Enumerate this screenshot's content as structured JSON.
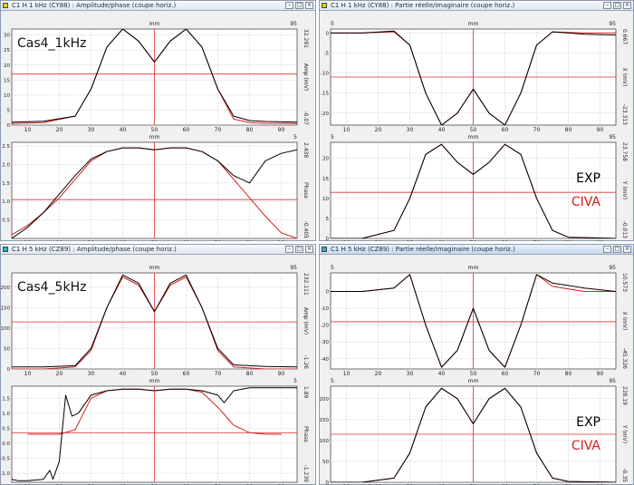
{
  "colors": {
    "exp": "#000000",
    "civa": "#d42020",
    "crosshair": "#e03030",
    "grid": "#b8b8b8",
    "accent_cyan": "#2fb0c8",
    "accent_yellow": "#e8d000"
  },
  "windows": [
    {
      "title": "C1 H 1 kHz (CY88) : Amplitude/phase (coupe horiz.)",
      "icon_color": "#e8d000",
      "active": false,
      "case_label": "Cas4_1kHz",
      "legend": null,
      "plots": [
        {
          "xlabel": "mm",
          "xmax_label": "95",
          "ylabel": "Amp (mV)",
          "right_top": "32.291",
          "right_bottom": "-0.07",
          "ylim": [
            0,
            32
          ],
          "yticks": [
            "0",
            "5",
            "10",
            "15",
            "20",
            "25",
            "30"
          ],
          "xticks": [
            "10",
            "20",
            "30",
            "40",
            "50",
            "60",
            "70",
            "80",
            "90"
          ],
          "hline": 17,
          "vline": 50
        },
        {
          "xlabel": "mm",
          "xmax_label": "5",
          "ylabel": "Phase",
          "right_top": "2.438",
          "right_bottom": "-0.405",
          "ylim": [
            0,
            2.6
          ],
          "yticks": [
            "0.5",
            "1.0",
            "1.5",
            "2.0",
            "2.5"
          ],
          "xticks": [
            "10",
            "20",
            "30",
            "40",
            "50",
            "60",
            "70",
            "80",
            "90"
          ],
          "hline": 1.05,
          "vline": 50
        }
      ]
    },
    {
      "title": "C1 H 1 kHz (CY88) : Partie réelle/imaginaire (coupe horiz.)",
      "icon_color": "#e8d000",
      "active": false,
      "case_label": null,
      "legend": {
        "exp": "EXP",
        "civa": "CIVA"
      },
      "plots": [
        {
          "xlabel": "mm",
          "xmax_label": "95",
          "xmin_label": "5",
          "ylabel": "X (mV)",
          "right_top": "0.667",
          "right_bottom": "-23.313",
          "ylim": [
            -23,
            1
          ],
          "yticks": [
            "0",
            "-5",
            "-10",
            "-15",
            "-20"
          ],
          "xticks": [
            "10",
            "20",
            "30",
            "40",
            "50",
            "60",
            "70",
            "80",
            "90"
          ],
          "hline": -11,
          "vline": 50
        },
        {
          "xlabel": "mm",
          "xmax_label": "95",
          "xmin_label": "5",
          "ylabel": "Y (mV)",
          "right_top": "23.758",
          "right_bottom": "-0.013",
          "ylim": [
            0,
            24
          ],
          "yticks": [
            "0",
            "5",
            "10",
            "15",
            "20"
          ],
          "xticks": [
            "10",
            "20",
            "30",
            "40",
            "50",
            "60",
            "70",
            "80",
            "90"
          ],
          "hline": 11.5,
          "vline": 50
        }
      ]
    },
    {
      "title": "C1 H 5 kHz (CZ89) : Amplitude/phase (coupe horiz.)",
      "icon_color": "#2fb0c8",
      "active": false,
      "case_label": "Cas4_5kHz",
      "legend": null,
      "plots": [
        {
          "xlabel": "mm",
          "xmax_label": "95",
          "ylabel": "Amp (mV)",
          "right_top": "232.111",
          "right_bottom": "-1.26",
          "ylim": [
            0,
            235
          ],
          "yticks": [
            "0",
            "50",
            "100",
            "150",
            "200"
          ],
          "xticks": [
            "10",
            "20",
            "30",
            "40",
            "50",
            "60",
            "70",
            "80",
            "90"
          ],
          "hline": 115,
          "vline": 50
        },
        {
          "xlabel": "mm",
          "xmax_label": "5",
          "ylabel": "Phase",
          "right_top": "1.89",
          "right_bottom": "-1.239",
          "ylim": [
            -1.3,
            1.9
          ],
          "yticks": [
            "-1.0",
            "-0.5",
            "0.0",
            "0.5",
            "1.0",
            "1.5"
          ],
          "xticks": [
            "10",
            "20",
            "30",
            "40",
            "50",
            "60",
            "70",
            "80",
            "90"
          ],
          "hline": 0.35,
          "vline": 50
        }
      ]
    },
    {
      "title": "C1 H 5 kHz (CZ89) : Partie réelle/imaginaire (coupe horiz.)",
      "icon_color": "#2fb0c8",
      "active": true,
      "case_label": null,
      "legend": {
        "exp": "EXP",
        "civa": "CIVA"
      },
      "plots": [
        {
          "xlabel": "mm",
          "xmax_label": "95",
          "xmin_label": "5",
          "ylabel": "X (mV)",
          "right_top": "10.573",
          "right_bottom": "-45.326",
          "ylim": [
            -46,
            11
          ],
          "yticks": [
            "0",
            "-10",
            "-20",
            "-30",
            "-40"
          ],
          "xticks": [
            "10",
            "20",
            "30",
            "40",
            "50",
            "60",
            "70",
            "80",
            "90"
          ],
          "hline": -18,
          "vline": 50
        },
        {
          "xlabel": "mm",
          "xmax_label": "95",
          "xmin_label": "5",
          "ylabel": "Y (mV)",
          "right_top": "228.19",
          "right_bottom": "-0.35",
          "ylim": [
            0,
            230
          ],
          "yticks": [
            "0",
            "50",
            "100",
            "150",
            "200"
          ],
          "xticks": [
            "10",
            "20",
            "30",
            "40",
            "50",
            "60",
            "70",
            "80",
            "90"
          ],
          "hline": 115,
          "vline": 50
        }
      ]
    }
  ],
  "chart_data": [
    {
      "type": "line",
      "title": "",
      "xlabel": "mm",
      "ylabel": "Amp (mV)",
      "xlim": [
        5,
        95
      ],
      "ylim": [
        0,
        32
      ],
      "series": [
        {
          "name": "EXP",
          "x": [
            5,
            15,
            25,
            30,
            35,
            40,
            45,
            50,
            55,
            60,
            65,
            70,
            75,
            80,
            85,
            95
          ],
          "y": [
            1,
            1.3,
            3,
            12,
            26,
            32,
            28,
            21,
            28,
            32,
            26,
            12,
            3,
            1.5,
            1.2,
            1
          ]
        },
        {
          "name": "CIVA",
          "x": [
            5,
            15,
            25,
            30,
            35,
            40,
            45,
            50,
            55,
            60,
            65,
            70,
            75,
            80,
            85,
            95
          ],
          "y": [
            0.5,
            0.8,
            3,
            12,
            26,
            32,
            28,
            21,
            28,
            32,
            26,
            12,
            2,
            0.8,
            0.6,
            0.5
          ]
        }
      ]
    },
    {
      "type": "line",
      "title": "",
      "xlabel": "mm",
      "ylabel": "Phase",
      "xlim": [
        5,
        95
      ],
      "ylim": [
        0,
        2.6
      ],
      "series": [
        {
          "name": "EXP",
          "x": [
            5,
            10,
            15,
            20,
            25,
            30,
            35,
            40,
            45,
            50,
            55,
            60,
            65,
            70,
            75,
            80,
            85,
            90,
            95
          ],
          "y": [
            0,
            0.3,
            0.7,
            1.2,
            1.7,
            2.15,
            2.35,
            2.45,
            2.45,
            2.4,
            2.45,
            2.45,
            2.35,
            2.1,
            1.7,
            1.5,
            2.1,
            2.3,
            2.4
          ]
        },
        {
          "name": "CIVA",
          "x": [
            5,
            10,
            15,
            20,
            25,
            30,
            35,
            40,
            45,
            50,
            55,
            60,
            65,
            70,
            75,
            80,
            85,
            90,
            95
          ],
          "y": [
            0.1,
            0.35,
            0.7,
            1.1,
            1.6,
            2.1,
            2.35,
            2.45,
            2.45,
            2.4,
            2.45,
            2.45,
            2.35,
            2.1,
            1.6,
            1.1,
            0.6,
            0.15,
            0
          ]
        }
      ]
    },
    {
      "type": "line",
      "title": "",
      "xlabel": "mm",
      "ylabel": "X (mV)",
      "xlim": [
        5,
        95
      ],
      "ylim": [
        -23,
        1
      ],
      "series": [
        {
          "name": "EXP",
          "x": [
            5,
            15,
            25,
            30,
            35,
            40,
            45,
            50,
            55,
            60,
            65,
            70,
            75,
            85,
            95
          ],
          "y": [
            0,
            0,
            0.5,
            -3,
            -15,
            -23,
            -20,
            -14,
            -20,
            -23,
            -15,
            -3,
            0.3,
            -0.3,
            -0.5
          ]
        },
        {
          "name": "CIVA",
          "x": [
            5,
            15,
            25,
            30,
            35,
            40,
            45,
            50,
            55,
            60,
            65,
            70,
            75,
            85,
            95
          ],
          "y": [
            0,
            0,
            0.3,
            -3,
            -15,
            -23,
            -20,
            -14,
            -20,
            -23,
            -15,
            -3,
            0.3,
            0,
            0
          ]
        }
      ]
    },
    {
      "type": "line",
      "title": "",
      "xlabel": "mm",
      "ylabel": "Y (mV)",
      "xlim": [
        5,
        95
      ],
      "ylim": [
        0,
        24
      ],
      "series": [
        {
          "name": "EXP",
          "x": [
            5,
            15,
            25,
            30,
            35,
            40,
            45,
            50,
            55,
            60,
            65,
            70,
            75,
            80,
            95
          ],
          "y": [
            0,
            0,
            2,
            10,
            21,
            23.5,
            19,
            16,
            19,
            23.5,
            21,
            10,
            2,
            0.3,
            0
          ]
        },
        {
          "name": "CIVA",
          "x": [
            5,
            15,
            25,
            30,
            35,
            40,
            45,
            50,
            55,
            60,
            65,
            70,
            75,
            80,
            95
          ],
          "y": [
            0,
            0,
            2,
            10,
            21,
            23.5,
            19,
            16,
            19,
            23.5,
            21,
            10,
            2,
            0.3,
            0
          ]
        }
      ]
    },
    {
      "type": "line",
      "title": "",
      "xlabel": "mm",
      "ylabel": "Amp (mV)",
      "xlim": [
        5,
        95
      ],
      "ylim": [
        0,
        235
      ],
      "series": [
        {
          "name": "EXP",
          "x": [
            5,
            15,
            25,
            30,
            35,
            40,
            45,
            50,
            55,
            60,
            65,
            70,
            75,
            85,
            95
          ],
          "y": [
            5,
            5,
            8,
            50,
            150,
            230,
            210,
            140,
            210,
            230,
            150,
            50,
            10,
            6,
            5
          ]
        },
        {
          "name": "CIVA",
          "x": [
            5,
            15,
            25,
            30,
            35,
            40,
            45,
            50,
            55,
            60,
            65,
            70,
            75,
            85,
            95
          ],
          "y": [
            0,
            0,
            5,
            45,
            150,
            225,
            205,
            140,
            205,
            225,
            150,
            45,
            5,
            0,
            0
          ]
        }
      ]
    },
    {
      "type": "line",
      "title": "",
      "xlabel": "mm",
      "ylabel": "Phase",
      "xlim": [
        5,
        95
      ],
      "ylim": [
        -1.3,
        1.9
      ],
      "series": [
        {
          "name": "EXP",
          "x": [
            5,
            7,
            10,
            15,
            17,
            18,
            20,
            22,
            24,
            26,
            30,
            35,
            40,
            45,
            50,
            55,
            60,
            65,
            70,
            72,
            75,
            80,
            85,
            95
          ],
          "y": [
            -1.2,
            -1.25,
            -1.25,
            -1.2,
            -0.9,
            -1.2,
            -0.6,
            1.6,
            0.9,
            1.0,
            1.6,
            1.75,
            1.8,
            1.8,
            1.75,
            1.8,
            1.8,
            1.75,
            1.6,
            1.35,
            1.75,
            1.85,
            1.85,
            1.85
          ]
        },
        {
          "name": "CIVA",
          "x": [
            10,
            20,
            25,
            30,
            35,
            40,
            45,
            50,
            55,
            60,
            65,
            70,
            75,
            80,
            85,
            90
          ],
          "y": [
            0.3,
            0.3,
            0.45,
            1.5,
            1.75,
            1.8,
            1.8,
            1.75,
            1.8,
            1.8,
            1.7,
            1.2,
            0.6,
            0.35,
            0.3,
            0.3
          ]
        }
      ]
    },
    {
      "type": "line",
      "title": "",
      "xlabel": "mm",
      "ylabel": "X (mV)",
      "xlim": [
        5,
        95
      ],
      "ylim": [
        -46,
        11
      ],
      "series": [
        {
          "name": "EXP",
          "x": [
            5,
            15,
            25,
            30,
            35,
            40,
            45,
            50,
            55,
            60,
            65,
            70,
            75,
            85,
            95
          ],
          "y": [
            0,
            0,
            2,
            10,
            -20,
            -45,
            -35,
            -10,
            -35,
            -45,
            -20,
            10,
            5,
            2,
            0
          ]
        },
        {
          "name": "CIVA",
          "x": [
            5,
            15,
            25,
            30,
            35,
            40,
            45,
            50,
            55,
            60,
            65,
            70,
            75,
            85,
            95
          ],
          "y": [
            0,
            0,
            2,
            10,
            -20,
            -45,
            -35,
            -10,
            -35,
            -45,
            -20,
            10,
            3,
            0,
            0
          ]
        }
      ]
    },
    {
      "type": "line",
      "title": "",
      "xlabel": "mm",
      "ylabel": "Y (mV)",
      "xlim": [
        5,
        95
      ],
      "ylim": [
        0,
        230
      ],
      "series": [
        {
          "name": "EXP",
          "x": [
            5,
            15,
            25,
            30,
            35,
            40,
            45,
            50,
            55,
            60,
            65,
            70,
            75,
            80,
            95
          ],
          "y": [
            0,
            0,
            10,
            70,
            180,
            225,
            200,
            140,
            200,
            225,
            180,
            70,
            10,
            2,
            0
          ]
        },
        {
          "name": "CIVA",
          "x": [
            5,
            15,
            25,
            30,
            35,
            40,
            45,
            50,
            55,
            60,
            65,
            70,
            75,
            80,
            95
          ],
          "y": [
            0,
            0,
            10,
            70,
            180,
            225,
            200,
            140,
            200,
            225,
            180,
            70,
            10,
            2,
            0
          ]
        }
      ]
    }
  ]
}
